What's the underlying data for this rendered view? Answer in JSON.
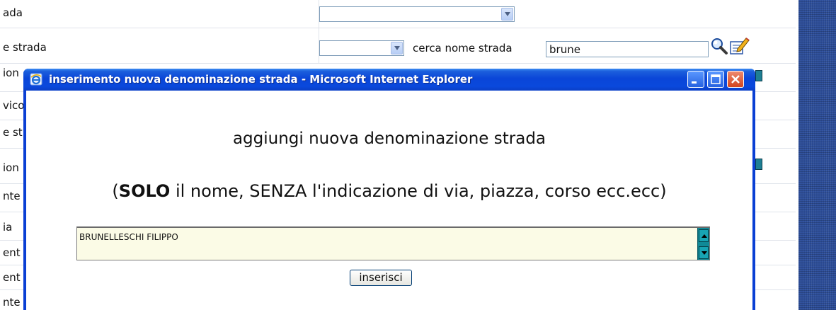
{
  "form": {
    "rows": [
      {
        "label": "ada"
      },
      {
        "label": "e strada"
      },
      {
        "label": "ion"
      },
      {
        "label": "vico"
      },
      {
        "label": "e st"
      },
      {
        "label": "ion"
      },
      {
        "label": "nte"
      },
      {
        "label": "ia"
      },
      {
        "label": "ent"
      },
      {
        "label": "ent"
      },
      {
        "label": "nte"
      }
    ],
    "search_label": "cerca nome strada",
    "search_value": "brune"
  },
  "popup": {
    "title": "inserimento nuova denominazione strada - Microsoft Internet Explorer",
    "heading": "aggiungi nuova denominazione strada",
    "instruction_prefix": "(",
    "instruction_bold1": "SOLO",
    "instruction_mid": " il nome, SENZA l'indicazione di via, piazza, corso ecc.ecc)",
    "name_value": "BRUNELLESCHI FILIPPO",
    "insert_label": "inserisci"
  },
  "icons": [
    "magnifier-icon",
    "edit-address-icon",
    "ie-logo-icon",
    "minimize-icon",
    "maximize-icon",
    "close-icon"
  ],
  "colors": {
    "titlebar": "#0a45d8",
    "close_button": "#d3451e",
    "textarea_bg": "#fbfbe6",
    "scrollbar": "#108a97",
    "side_panel": "#2d4e9a"
  }
}
